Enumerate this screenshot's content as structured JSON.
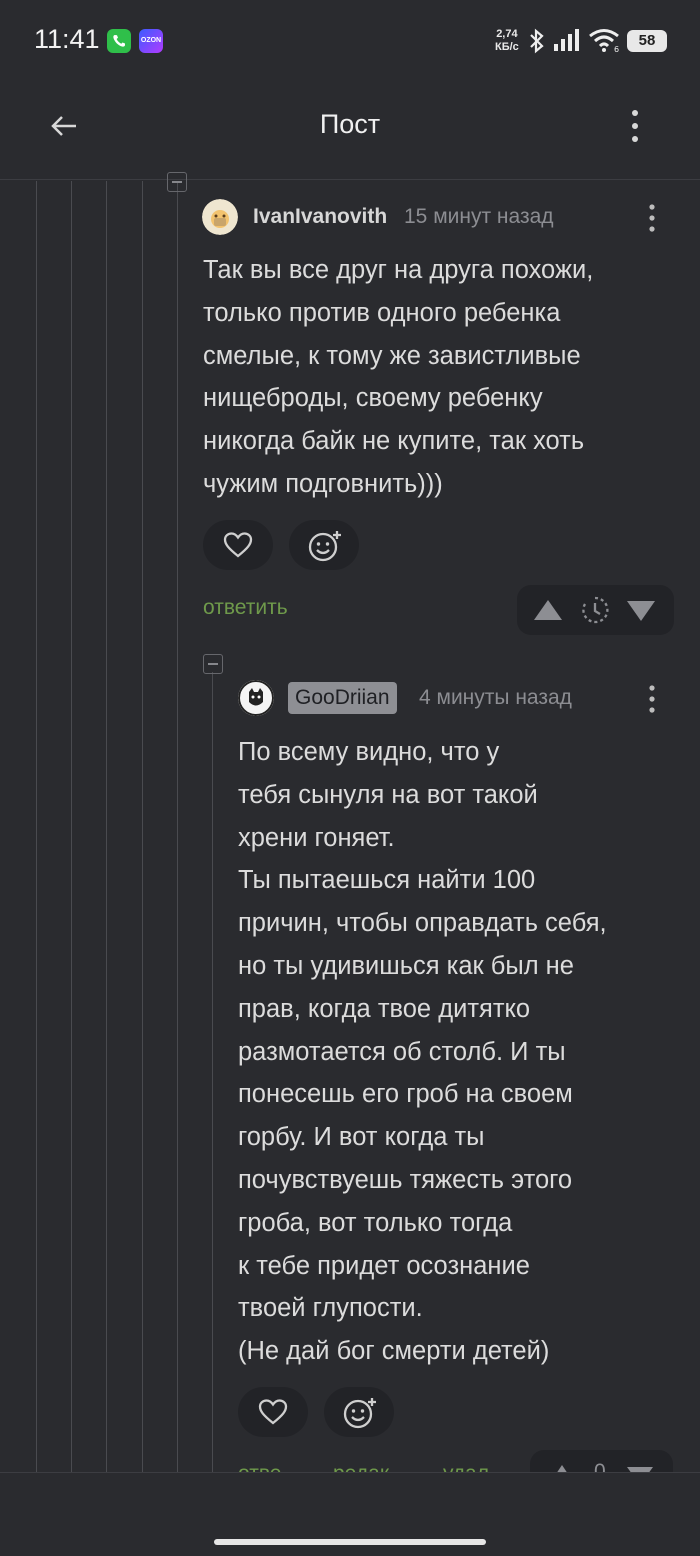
{
  "status_bar": {
    "time": "11:41",
    "net_speed_value": "2,74",
    "net_speed_unit": "КБ/с",
    "battery": "58",
    "app_badges": [
      "phone-icon",
      "ozon-icon"
    ],
    "ozon_label": "OZON",
    "icons": [
      "bluetooth-icon",
      "signal-icon",
      "wifi-icon",
      "battery-icon"
    ]
  },
  "app_bar": {
    "title": "Пост",
    "back_icon": "arrow-left-icon",
    "menu_icon": "more-vertical-icon"
  },
  "comments": [
    {
      "author": "IvanIvanovith",
      "time_ago": "15 минут назад",
      "text": "Так вы все друг на друга похожи,\nтолько против одного ребенка\nсмелые, к тому же завистливые\nнищеброды, своему ребенку\nникогда байк не купите, так хоть\nчужим подговнить)))",
      "reply_label": "ответить"
    },
    {
      "author": "GooDriian",
      "time_ago": "4 минуты назад",
      "text": "По всему видно, что у\nтебя сынуля на вот такой\nхрени гоняет.\nТы пытаешься найти 100\nпричин, чтобы оправдать себя,\nно ты удивишься как был не\nправ, когда твое дитятко\nразмотается об столб. И ты\nпонесешь его гроб на своем\nгорбу. И вот когда ты\nпочувствуешь тяжесть этого\nгроба, вот только тогда\nк тебе придет осознание\nтвоей глупости.\n(Не дай бог смерти детей)",
      "cut_actions": [
        "отве",
        "редак",
        "удал"
      ],
      "cut_vote": "0"
    }
  ],
  "colors": {
    "background": "#2a2b2f",
    "text": "#dcdcdc",
    "muted": "#8c8d92",
    "reply_link": "#6f9a4b",
    "button_bg": "#222327"
  }
}
